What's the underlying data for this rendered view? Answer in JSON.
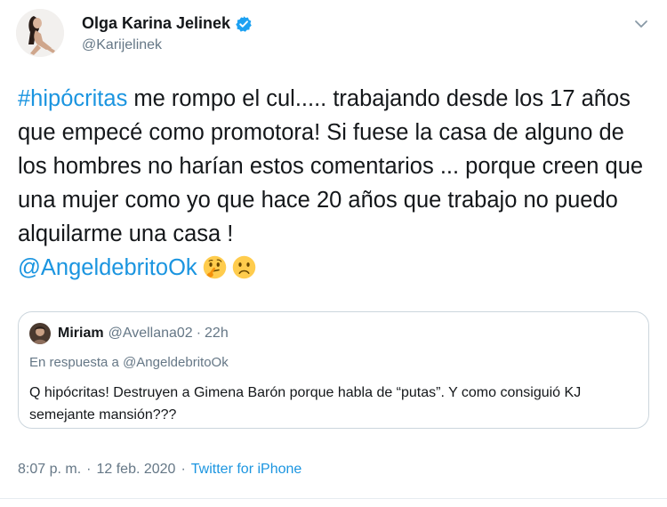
{
  "author": {
    "display_name": "Olga Karina Jelinek",
    "handle": "@Karijelinek"
  },
  "tweet": {
    "hashtag": "#hipócritas",
    "text_main": " me rompo el cul..... trabajando desde los 17 años que empecé como promotora! Si fuese la casa de alguno de los hombres no harían estos comentarios ... porque creen que una mujer como yo que hace 20 años que trabajo no puedo alquilarme una casa !",
    "mention": "@AngeldebritoOk",
    "emojis": [
      "thinking-face",
      "slightly-frowning-face"
    ]
  },
  "quoted": {
    "name": "Miriam",
    "handle": "@Avellana02",
    "dot": "·",
    "time": "22h",
    "reply_prefix": "En respuesta a",
    "reply_to": "@AngeldebritoOk",
    "text": "Q hipócritas! Destruyen a Gimena Barón porque habla de “putas”. Y como consiguió KJ semejante mansión???"
  },
  "footer": {
    "time": "8:07 p. m.",
    "sep1": "·",
    "date": "12 feb. 2020",
    "sep2": "·",
    "source": "Twitter for iPhone"
  },
  "colors": {
    "link": "#1b95e0",
    "muted": "#657786",
    "text": "#14171a",
    "border": "#ccd6dd",
    "verified": "#1da1f2"
  }
}
